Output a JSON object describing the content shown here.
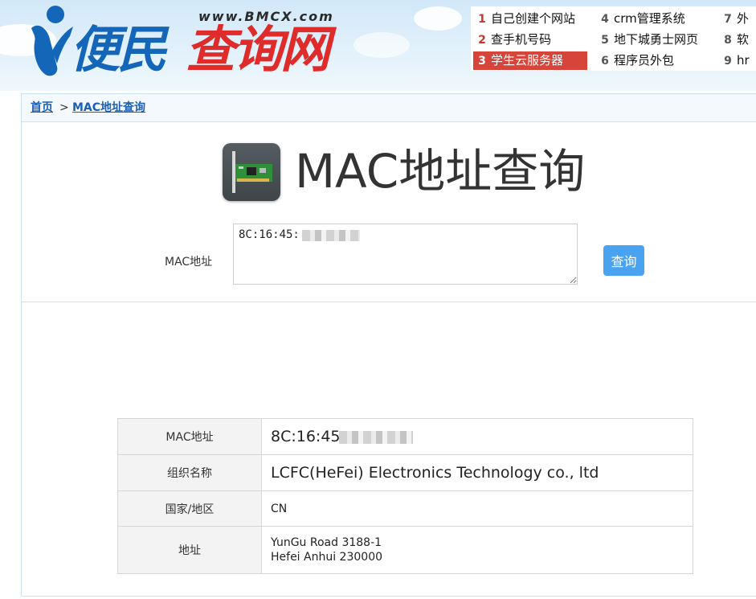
{
  "site": {
    "logo_url": "www.BMCX.com",
    "logo_text_blue": "便民",
    "logo_text_red": "查询网"
  },
  "hot_links": [
    {
      "num": "1",
      "label": "自己创建个网站"
    },
    {
      "num": "2",
      "label": "查手机号码"
    },
    {
      "num": "3",
      "label": "学生云服务器"
    },
    {
      "num": "4",
      "label": "crm管理系统"
    },
    {
      "num": "5",
      "label": "地下城勇士网页"
    },
    {
      "num": "6",
      "label": "程序员外包"
    },
    {
      "num": "7",
      "label": "外"
    },
    {
      "num": "8",
      "label": "软"
    },
    {
      "num": "9",
      "label": "hr"
    }
  ],
  "breadcrumb": {
    "home": "首页",
    "separator": ">",
    "current": "MAC地址查询"
  },
  "page": {
    "title": "MAC地址查询",
    "icon": "network-card-icon"
  },
  "form": {
    "label": "MAC地址",
    "input_value": "8C:16:45:",
    "button_label": "查询"
  },
  "result": {
    "rows": [
      {
        "label": "MAC地址",
        "value": "8C:16:45"
      },
      {
        "label": "组织名称",
        "value": "LCFC(HeFei) Electronics Technology co., ltd"
      },
      {
        "label": "国家/地区",
        "value": "CN"
      },
      {
        "label": "地址",
        "value_line1": "YunGu Road 3188-1",
        "value_line2": "Hefei Anhui 230000"
      }
    ]
  },
  "colors": {
    "link_blue": "#1a5fb4",
    "active_red": "#d6443a",
    "button_blue": "#4aa3f1"
  }
}
